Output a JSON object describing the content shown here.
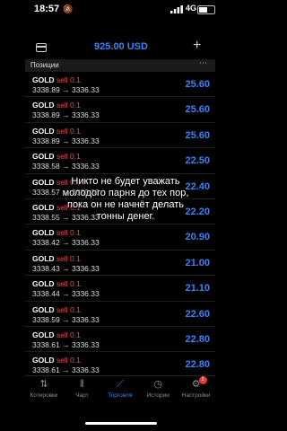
{
  "status": {
    "time": "18:57",
    "network": "4G"
  },
  "header": {
    "balance": "925.00 USD"
  },
  "section": {
    "title": "Позиции"
  },
  "positions": [
    {
      "symbol": "GOLD",
      "type": "sell 0.1",
      "open": "3338.89",
      "current": "3336.33",
      "profit": "25.60"
    },
    {
      "symbol": "GOLD",
      "type": "sell 0.1",
      "open": "3338.89",
      "current": "3336.33",
      "profit": "25.60"
    },
    {
      "symbol": "GOLD",
      "type": "sell 0.1",
      "open": "3338.89",
      "current": "3336.33",
      "profit": "25.60"
    },
    {
      "symbol": "GOLD",
      "type": "sell 0.1",
      "open": "3338.58",
      "current": "3336.33",
      "profit": "22.50"
    },
    {
      "symbol": "GOLD",
      "type": "sell 0.1",
      "open": "3338.57",
      "current": "3336.33",
      "profit": "22.40"
    },
    {
      "symbol": "GOLD",
      "type": "sell 0.1",
      "open": "3338.55",
      "current": "3336.33",
      "profit": "22.20"
    },
    {
      "symbol": "GOLD",
      "type": "sell 0.1",
      "open": "3338.42",
      "current": "3336.33",
      "profit": "20.90"
    },
    {
      "symbol": "GOLD",
      "type": "sell 0.1",
      "open": "3338.43",
      "current": "3336.33",
      "profit": "21.00"
    },
    {
      "symbol": "GOLD",
      "type": "sell 0.1",
      "open": "3338.44",
      "current": "3336.33",
      "profit": "21.10"
    },
    {
      "symbol": "GOLD",
      "type": "sell 0.1",
      "open": "3338.59",
      "current": "3336.33",
      "profit": "22.60"
    },
    {
      "symbol": "GOLD",
      "type": "sell 0.1",
      "open": "3338.61",
      "current": "3336.33",
      "profit": "22.80"
    },
    {
      "symbol": "GOLD",
      "type": "sell 0.1",
      "open": "3338.61",
      "current": "3336.33",
      "profit": "22.80"
    }
  ],
  "caption": "Никто не будет уважать молодого парня до тех пор, пока он не начнёт делать тонны денег.",
  "tabs": [
    {
      "label": "Котировки",
      "icon": "quotes-arrows-icon",
      "active": false
    },
    {
      "label": "Чарт",
      "icon": "chart-candles-icon",
      "active": false
    },
    {
      "label": "Торговля",
      "icon": "trade-icon",
      "active": true
    },
    {
      "label": "Истории",
      "icon": "history-clock-icon",
      "active": false
    },
    {
      "label": "Настройки",
      "icon": "settings-gear-icon",
      "active": false,
      "badge": "1"
    }
  ],
  "colors": {
    "accent": "#3b82f6",
    "sell": "#e05252",
    "background": "#000000",
    "section": "#1b1b1d"
  }
}
